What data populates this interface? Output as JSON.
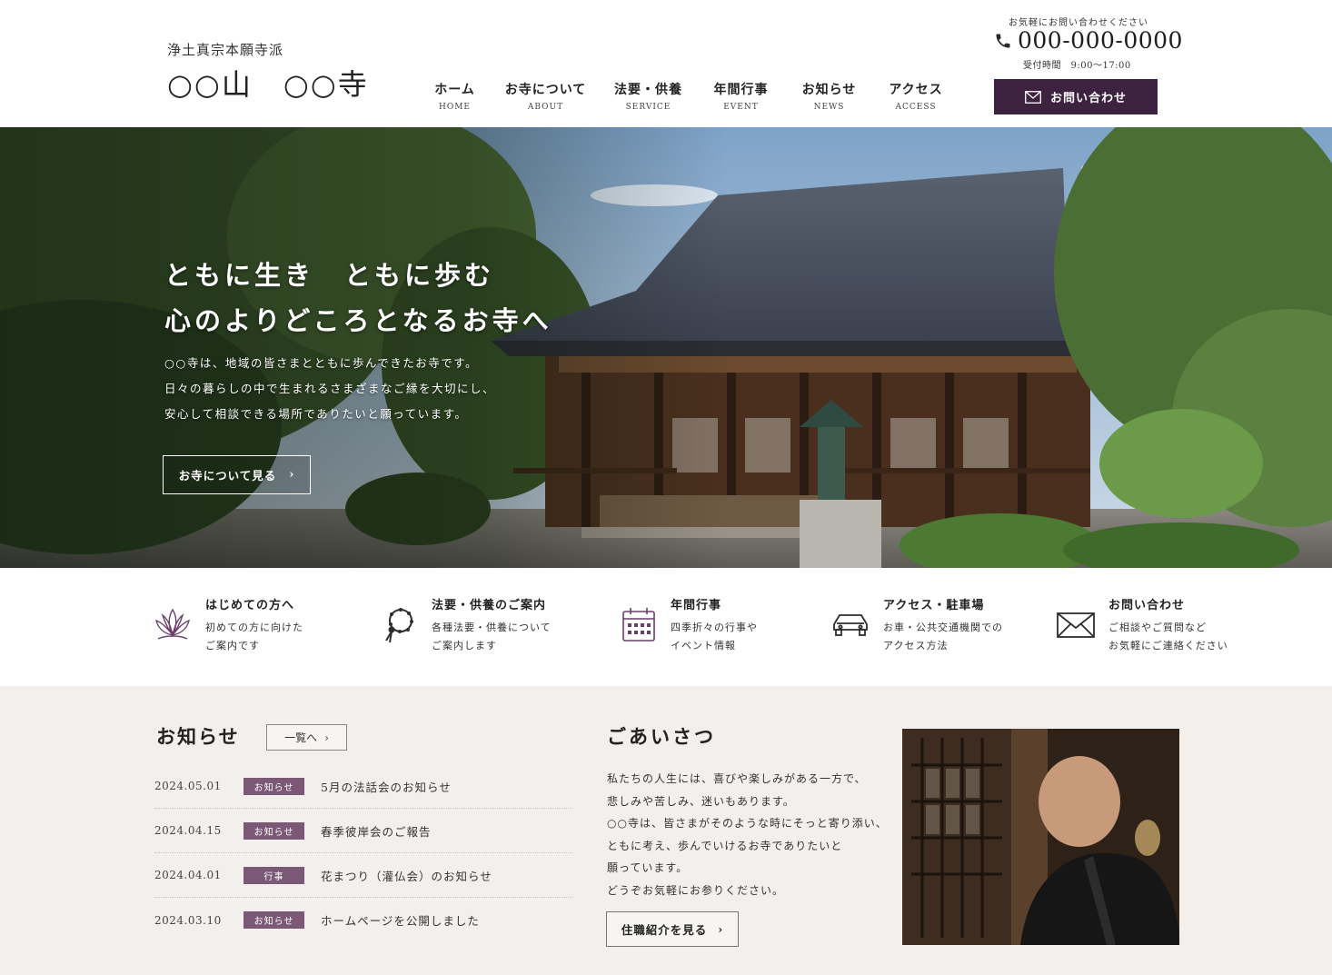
{
  "header": {
    "sect": "浄土真宗本願寺派",
    "temple": "○○山　○○寺",
    "contact_note": "お気軽にお問い合わせください",
    "phone": "000-000-0000",
    "hours": "受付時間　9:00〜17:00",
    "contact_button": "お問い合わせ",
    "nav": [
      {
        "ja": "ホーム",
        "en": "HOME"
      },
      {
        "ja": "お寺について",
        "en": "ABOUT"
      },
      {
        "ja": "法要・供養",
        "en": "SERVICE"
      },
      {
        "ja": "年間行事",
        "en": "EVENT"
      },
      {
        "ja": "お知らせ",
        "en": "NEWS"
      },
      {
        "ja": "アクセス",
        "en": "ACCESS"
      }
    ]
  },
  "hero": {
    "title": [
      "ともに生き　ともに歩む",
      "心のよりどころとなるお寺へ"
    ],
    "text": [
      "○○寺は、地域の皆さまとともに歩んできたお寺です。",
      "日々の暮らしの中で生まれるさまざまなご縁を大切にし、",
      "安心して相談できる場所でありたいと願っています。"
    ],
    "button": "お寺について見る",
    "chevron": "›"
  },
  "services": [
    {
      "icon": "lotus-icon",
      "title": "はじめての方へ",
      "desc": [
        "初めての方に向けた",
        "ご案内です"
      ]
    },
    {
      "icon": "prayer-beads-icon",
      "title": "法要・供養のご案内",
      "desc": [
        "各種法要・供養について",
        "ご案内します"
      ]
    },
    {
      "icon": "calendar-icon",
      "title": "年間行事",
      "desc": [
        "四季折々の行事や",
        "イベント情報"
      ]
    },
    {
      "icon": "car-icon",
      "title": "アクセス・駐車場",
      "desc": [
        "お車・公共交通機関での",
        "アクセス方法"
      ]
    },
    {
      "icon": "mail-icon",
      "title": "お問い合わせ",
      "desc": [
        "ご相談やご質問など",
        "お気軽にご連絡ください"
      ]
    }
  ],
  "news": {
    "title": "お知らせ",
    "more": "一覧へ",
    "items": [
      {
        "date": "2024.05.01",
        "tag": "お知らせ",
        "text": "5月の法話会のお知らせ"
      },
      {
        "date": "2024.04.15",
        "tag": "お知らせ",
        "text": "春季彼岸会のご報告"
      },
      {
        "date": "2024.04.01",
        "tag": "行事",
        "text": "花まつり（灌仏会）のお知らせ"
      },
      {
        "date": "2024.03.10",
        "tag": "お知らせ",
        "text": "ホームページを公開しました"
      }
    ]
  },
  "greeting": {
    "title": "ごあいさつ",
    "text": [
      "私たちの人生には、喜びや楽しみがある一方で、",
      "悲しみや苦しみ、迷いもあります。",
      "○○寺は、皆さまがそのような時にそっと寄り添い、",
      "ともに考え、歩んでいけるお寺でありたいと",
      "願っています。",
      "どうぞお気軽にお参りください。"
    ],
    "button": "住職紹介を見る"
  },
  "colors": {
    "accent": "#3e2340",
    "tag": "#7a5876",
    "section_bg": "#f2efec"
  }
}
